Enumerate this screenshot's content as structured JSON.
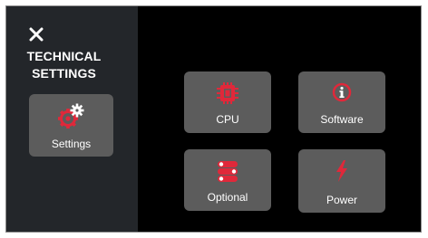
{
  "sidebar": {
    "title_line1": "TECHNICAL",
    "title_line2": "SETTINGS",
    "nav_item_label": "Settings",
    "nav_item_icon": "gear-icon"
  },
  "tiles": [
    {
      "label": "CPU",
      "icon": "cpu-chip-icon"
    },
    {
      "label": "Software",
      "icon": "info-icon"
    },
    {
      "label": "Optional",
      "icon": "toggle-list-icon"
    },
    {
      "label": "Power",
      "icon": "lightning-bolt-icon"
    }
  ],
  "colors": {
    "accent": "#e0283a",
    "sidebar_bg": "#23262a",
    "tile_bg": "#5c5c5c",
    "main_bg": "#000000"
  }
}
